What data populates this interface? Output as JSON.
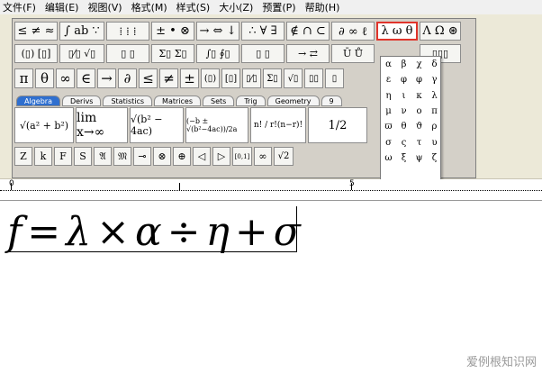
{
  "menu": [
    "文件(F)",
    "编辑(E)",
    "视图(V)",
    "格式(M)",
    "样式(S)",
    "大小(Z)",
    "预置(P)",
    "帮助(H)"
  ],
  "row1": [
    "≤ ≠ ≈",
    "∫ ab ∵",
    "⁞ ⁞ ⁞",
    "± • ⊗",
    "→ ⇔ ↓",
    "∴ ∀ ∃",
    "∉ ∩ ⊂",
    "∂ ∞ ℓ",
    "λ ω θ",
    "Λ Ω ⊛"
  ],
  "row2": [
    "(▯) [▯]",
    "▯⁄▯ √▯",
    "▯ ▯",
    "Σ▯ Σ▯",
    "∫▯ ∮▯",
    "▯ ▯",
    "→ ⇄",
    "Ū Ů",
    "▯▯▯"
  ],
  "row3": [
    "π",
    "θ",
    "∞",
    "∈",
    "→",
    "∂",
    "≤",
    "≠",
    "±",
    "(▯)",
    "[▯]",
    "▯⁄▯",
    "Σ▯",
    "√▯",
    "▯▯",
    "▯"
  ],
  "tabs": [
    "Algebra",
    "Derivs",
    "Statistics",
    "Matrices",
    "Sets",
    "Trig",
    "Geometry",
    "9"
  ],
  "templates": [
    "√(a² + b²)",
    "lim x→∞",
    "√(b² − 4ac)",
    "(−b ± √(b²−4ac))/2a",
    "n! / r!(n−r)!",
    "1/2"
  ],
  "row5": [
    "Z",
    "k",
    "F",
    "S",
    "𝔄",
    "𝔐",
    "⊸",
    "⊗",
    "⊕",
    "◁",
    "▷",
    "[0,1]",
    "∞",
    "√2"
  ],
  "greek": [
    "α",
    "β",
    "χ",
    "δ",
    "ε",
    "φ",
    "φ",
    "γ",
    "η",
    "ι",
    "κ",
    "λ",
    "μ",
    "ν",
    "ο",
    "π",
    "ϖ",
    "θ",
    "ϑ",
    "ρ",
    "σ",
    "ς",
    "τ",
    "υ",
    "ω",
    "ξ",
    "ψ",
    "ζ"
  ],
  "ruler": {
    "start": "0",
    "mid": "5"
  },
  "equation": {
    "f": "f",
    "eq": "=",
    "lambda": "λ",
    "times": "×",
    "alpha": "α",
    "div": "÷",
    "eta": "η",
    "plus": "+",
    "sigma": "σ"
  },
  "watermark": "爱例根知识网"
}
